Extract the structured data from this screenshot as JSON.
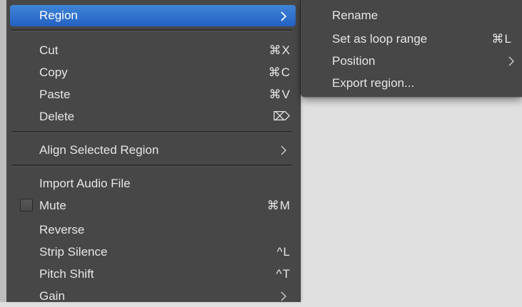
{
  "main_menu": {
    "region": {
      "label": "Region"
    },
    "cut": {
      "label": "Cut",
      "shortcut": "⌘X"
    },
    "copy": {
      "label": "Copy",
      "shortcut": "⌘C"
    },
    "paste": {
      "label": "Paste",
      "shortcut": "⌘V"
    },
    "delete": {
      "label": "Delete",
      "shortcut": "⌦"
    },
    "align": {
      "label": "Align Selected Region"
    },
    "import_audio": {
      "label": "Import Audio File"
    },
    "mute": {
      "label": "Mute",
      "shortcut": "⌘M",
      "checked": false
    },
    "reverse": {
      "label": "Reverse"
    },
    "strip_silence": {
      "label": "Strip Silence",
      "shortcut": "^L"
    },
    "pitch_shift": {
      "label": "Pitch Shift",
      "shortcut": "^T"
    },
    "gain": {
      "label": "Gain"
    }
  },
  "sub_menu": {
    "rename": {
      "label": "Rename"
    },
    "set_loop": {
      "label": "Set as loop range",
      "shortcut": "⌘L"
    },
    "position": {
      "label": "Position"
    },
    "export": {
      "label": "Export region..."
    }
  },
  "colors": {
    "menu_bg": "#474747",
    "highlight": "#2f6fd0",
    "text": "#e6e6e6",
    "desktop_bg": "#e0e0e0"
  }
}
